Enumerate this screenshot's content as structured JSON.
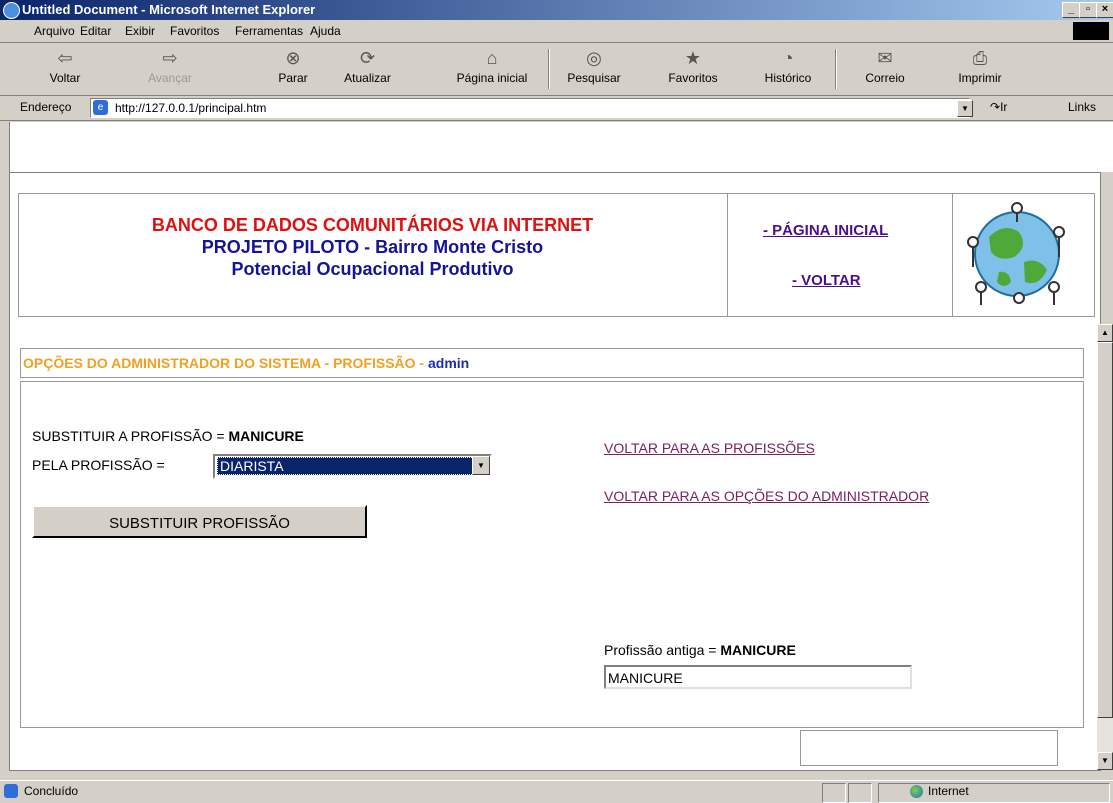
{
  "window": {
    "title": "Untitled Document - Microsoft Internet Explorer"
  },
  "menu": {
    "items": [
      "Arquivo",
      "Editar",
      "Exibir",
      "Favoritos",
      "Ferramentas",
      "Ajuda"
    ]
  },
  "toolbar": {
    "back": "Voltar",
    "forward": "Avançar",
    "stop": "Parar",
    "refresh": "Atualizar",
    "home": "Página inicial",
    "search": "Pesquisar",
    "favorites": "Favoritos",
    "history": "Histórico",
    "mail": "Correio",
    "print": "Imprimir"
  },
  "address": {
    "label": "Endereço",
    "url": "http://127.0.0.1/principal.htm",
    "go": "Ir",
    "links": "Links"
  },
  "header": {
    "line1": "BANCO DE DADOS COMUNITÁRIOS VIA INTERNET",
    "line2": "PROJETO PILOTO - Bairro Monte Cristo",
    "line3": "Potencial Ocupacional Produtivo",
    "nav_home": "- PÁGINA INICIAL",
    "nav_back": "- VOLTAR"
  },
  "admin": {
    "title": "OPÇÕES DO ADMINISTRADOR DO SISTEMA - PROFISSÃO",
    "title_sep": " - ",
    "user": "admin"
  },
  "form": {
    "replace_label": "SUBSTITUIR A PROFISSÃO = ",
    "replace_value": "MANICURE",
    "by_label": "PELA PROFISSÃO = ",
    "selected": "DIARISTA",
    "submit": "SUBSTITUIR PROFISSÃO",
    "old_label": "Profissão antiga = ",
    "old_value": "MANICURE",
    "old_input": "MANICURE"
  },
  "links": {
    "professions": "VOLTAR PARA AS PROFISSÕES",
    "admin_options": "VOLTAR PARA AS OPÇÕES DO ADMINISTRADOR"
  },
  "status": {
    "text": "Concluído",
    "zone": "Internet"
  }
}
